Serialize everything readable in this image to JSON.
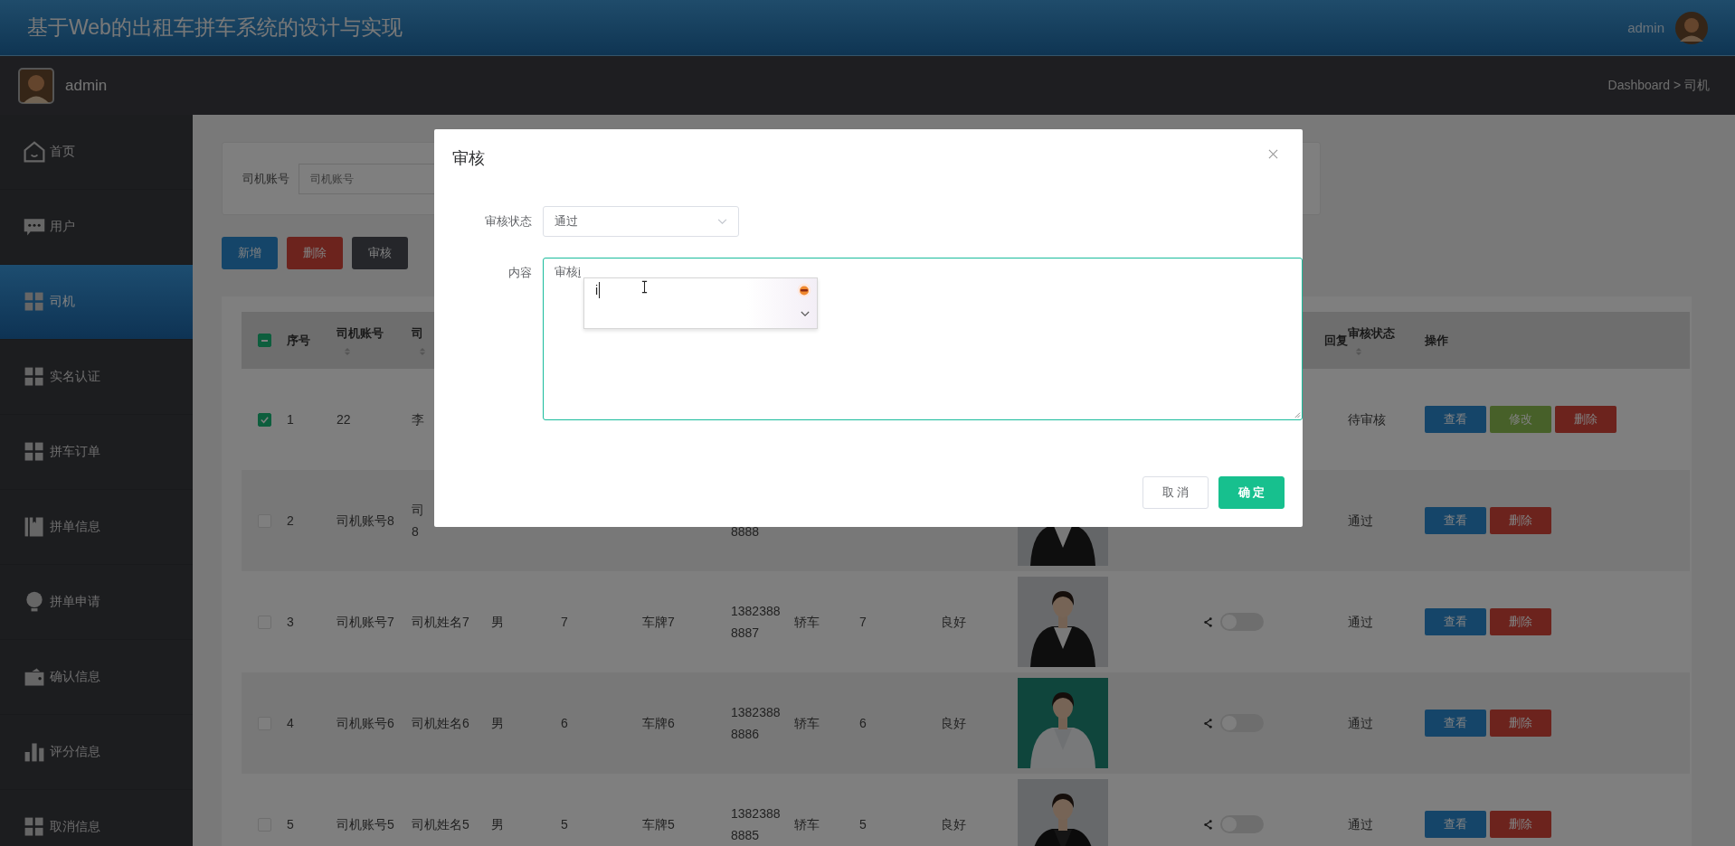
{
  "header": {
    "title": "基于Web的出租车拼车系统的设计与实现",
    "user": "admin"
  },
  "subheader": {
    "user": "admin",
    "breadcrumb": "Dashboard > 司机"
  },
  "sidebar": {
    "items": [
      {
        "label": "首页",
        "selected": false
      },
      {
        "label": "用户",
        "selected": false
      },
      {
        "label": "司机",
        "selected": true
      },
      {
        "label": "实名认证",
        "selected": false
      },
      {
        "label": "拼车订单",
        "selected": false
      },
      {
        "label": "拼单信息",
        "selected": false
      },
      {
        "label": "拼单申请",
        "selected": false
      },
      {
        "label": "确认信息",
        "selected": false
      },
      {
        "label": "评分信息",
        "selected": false
      },
      {
        "label": "取消信息",
        "selected": false
      }
    ]
  },
  "search": {
    "label": "司机账号",
    "placeholder": "司机账号"
  },
  "actions": [
    {
      "label": "新增",
      "kind": "primary"
    },
    {
      "label": "删除",
      "kind": "danger"
    },
    {
      "label": "审核",
      "kind": "dark"
    }
  ],
  "table": {
    "select_all": {
      "indeterminate": true
    },
    "columns": [
      {
        "label": "序号",
        "sortable": false
      },
      {
        "label": "司机账号",
        "sortable": true
      },
      {
        "label": "司",
        "sortable": true
      },
      {
        "label": "回复",
        "sortable": false
      },
      {
        "label": "审核状态",
        "sortable": true
      },
      {
        "label": "操作",
        "sortable": false
      }
    ],
    "rows": [
      {
        "checked": true,
        "index": "1",
        "account": "22",
        "name": "李",
        "audit_status": "待审核",
        "actions": [
          {
            "label": "查看",
            "kind": "view"
          },
          {
            "label": "修改",
            "kind": "edit"
          },
          {
            "label": "删除",
            "kind": "delete"
          }
        ]
      },
      {
        "checked": false,
        "index": "2",
        "account": "司机账号8",
        "name": "司\n8",
        "phone": "\n8888",
        "photo": {
          "kind": "picture"
        },
        "audit_status": "通过",
        "actions": [
          {
            "label": "查看",
            "kind": "view"
          },
          {
            "label": "删除",
            "kind": "delete"
          }
        ]
      },
      {
        "checked": false,
        "index": "3",
        "account": "司机账号7",
        "name": "司机姓名7",
        "gender": "男",
        "column_5": "7",
        "plate": "车牌7",
        "phone": "13823888887",
        "car_type": "轿车",
        "column_9": "7",
        "condition": "良好",
        "photo": {
          "kind": "picture"
        },
        "toggle": {
          "on": false
        },
        "audit_status": "通过",
        "actions": [
          {
            "label": "查看",
            "kind": "view"
          },
          {
            "label": "删除",
            "kind": "delete"
          }
        ]
      },
      {
        "checked": false,
        "index": "4",
        "account": "司机账号6",
        "name": "司机姓名6",
        "gender": "男",
        "column_5": "6",
        "plate": "车牌6",
        "phone": "13823888886",
        "car_type": "轿车",
        "column_9": "6",
        "condition": "良好",
        "photo": {
          "kind": "picture"
        },
        "toggle": {
          "on": false
        },
        "audit_status": "通过",
        "actions": [
          {
            "label": "查看",
            "kind": "view"
          },
          {
            "label": "删除",
            "kind": "delete"
          }
        ]
      },
      {
        "checked": false,
        "index": "5",
        "account": "司机账号5",
        "name": "司机姓名5",
        "gender": "男",
        "column_5": "5",
        "plate": "车牌5",
        "phone": "13823888885",
        "car_type": "轿车",
        "column_9": "5",
        "condition": "良好",
        "photo": {
          "kind": "picture"
        },
        "toggle": {
          "on": false
        },
        "audit_status": "通过",
        "actions": [
          {
            "label": "查看",
            "kind": "view"
          },
          {
            "label": "删除",
            "kind": "delete"
          }
        ]
      }
    ]
  },
  "dialog": {
    "title": "审核",
    "fields": [
      {
        "kind": "select",
        "label": "审核状态",
        "value": "通过"
      },
      {
        "kind": "textarea",
        "label": "内容",
        "value": "审核",
        "composition": "i"
      }
    ],
    "ime": {
      "text": "i"
    },
    "buttons": [
      {
        "label": "取 消",
        "kind": "cancel"
      },
      {
        "label": "确 定",
        "kind": "confirm"
      }
    ]
  }
}
